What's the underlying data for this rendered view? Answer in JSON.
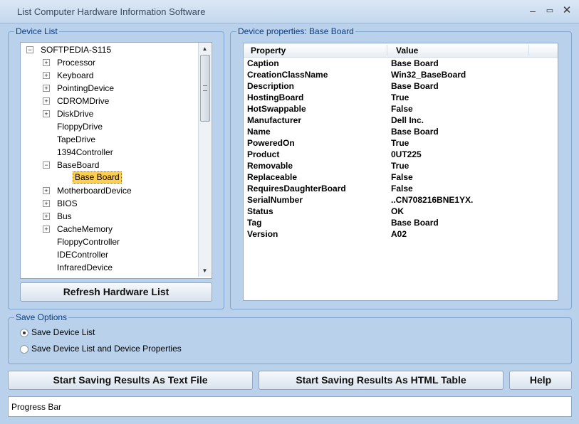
{
  "window": {
    "title": "List Computer Hardware Information Software"
  },
  "device_list": {
    "label": "Device List",
    "root": "SOFTPEDIA-S115",
    "items": [
      {
        "label": "Processor",
        "expandable": true
      },
      {
        "label": "Keyboard",
        "expandable": true
      },
      {
        "label": "PointingDevice",
        "expandable": true
      },
      {
        "label": "CDROMDrive",
        "expandable": true
      },
      {
        "label": "DiskDrive",
        "expandable": true
      },
      {
        "label": "FloppyDrive",
        "expandable": false
      },
      {
        "label": "TapeDrive",
        "expandable": false
      },
      {
        "label": "1394Controller",
        "expandable": false
      },
      {
        "label": "BaseBoard",
        "expandable": true,
        "expanded": true
      },
      {
        "label": "MotherboardDevice",
        "expandable": true
      },
      {
        "label": "BIOS",
        "expandable": true
      },
      {
        "label": "Bus",
        "expandable": true
      },
      {
        "label": "CacheMemory",
        "expandable": true
      },
      {
        "label": "FloppyController",
        "expandable": false
      },
      {
        "label": "IDEController",
        "expandable": false
      },
      {
        "label": "InfraredDevice",
        "expandable": false
      }
    ],
    "child": {
      "label": "Base Board",
      "selected": true
    },
    "refresh_button": "Refresh Hardware List"
  },
  "properties": {
    "label": "Device properties: Base Board",
    "columns": [
      "Property",
      "Value"
    ],
    "rows": [
      [
        "Caption",
        "Base Board"
      ],
      [
        "CreationClassName",
        "Win32_BaseBoard"
      ],
      [
        "Description",
        "Base Board"
      ],
      [
        "HostingBoard",
        "True"
      ],
      [
        "HotSwappable",
        "False"
      ],
      [
        "Manufacturer",
        "Dell Inc."
      ],
      [
        "Name",
        "Base Board"
      ],
      [
        "PoweredOn",
        "True"
      ],
      [
        "Product",
        "0UT225"
      ],
      [
        "Removable",
        "True"
      ],
      [
        "Replaceable",
        "False"
      ],
      [
        "RequiresDaughterBoard",
        "False"
      ],
      [
        "SerialNumber",
        "..CN708216BNE1YX."
      ],
      [
        "Status",
        "OK"
      ],
      [
        "Tag",
        "Base Board"
      ],
      [
        "Version",
        "A02"
      ]
    ]
  },
  "save_options": {
    "label": "Save Options",
    "options": [
      {
        "label": "Save Device List",
        "selected": true
      },
      {
        "label": "Save Device List and Device Properties",
        "selected": false
      }
    ]
  },
  "buttons": {
    "save_text": "Start Saving Results As Text File",
    "save_html": "Start Saving Results As HTML Table",
    "help": "Help"
  },
  "progress": {
    "label": "Progress Bar",
    "value": 0
  },
  "colors": {
    "background": "#b9d1ea",
    "group_label": "#0c3b82",
    "selection": "#ffcf4d"
  }
}
